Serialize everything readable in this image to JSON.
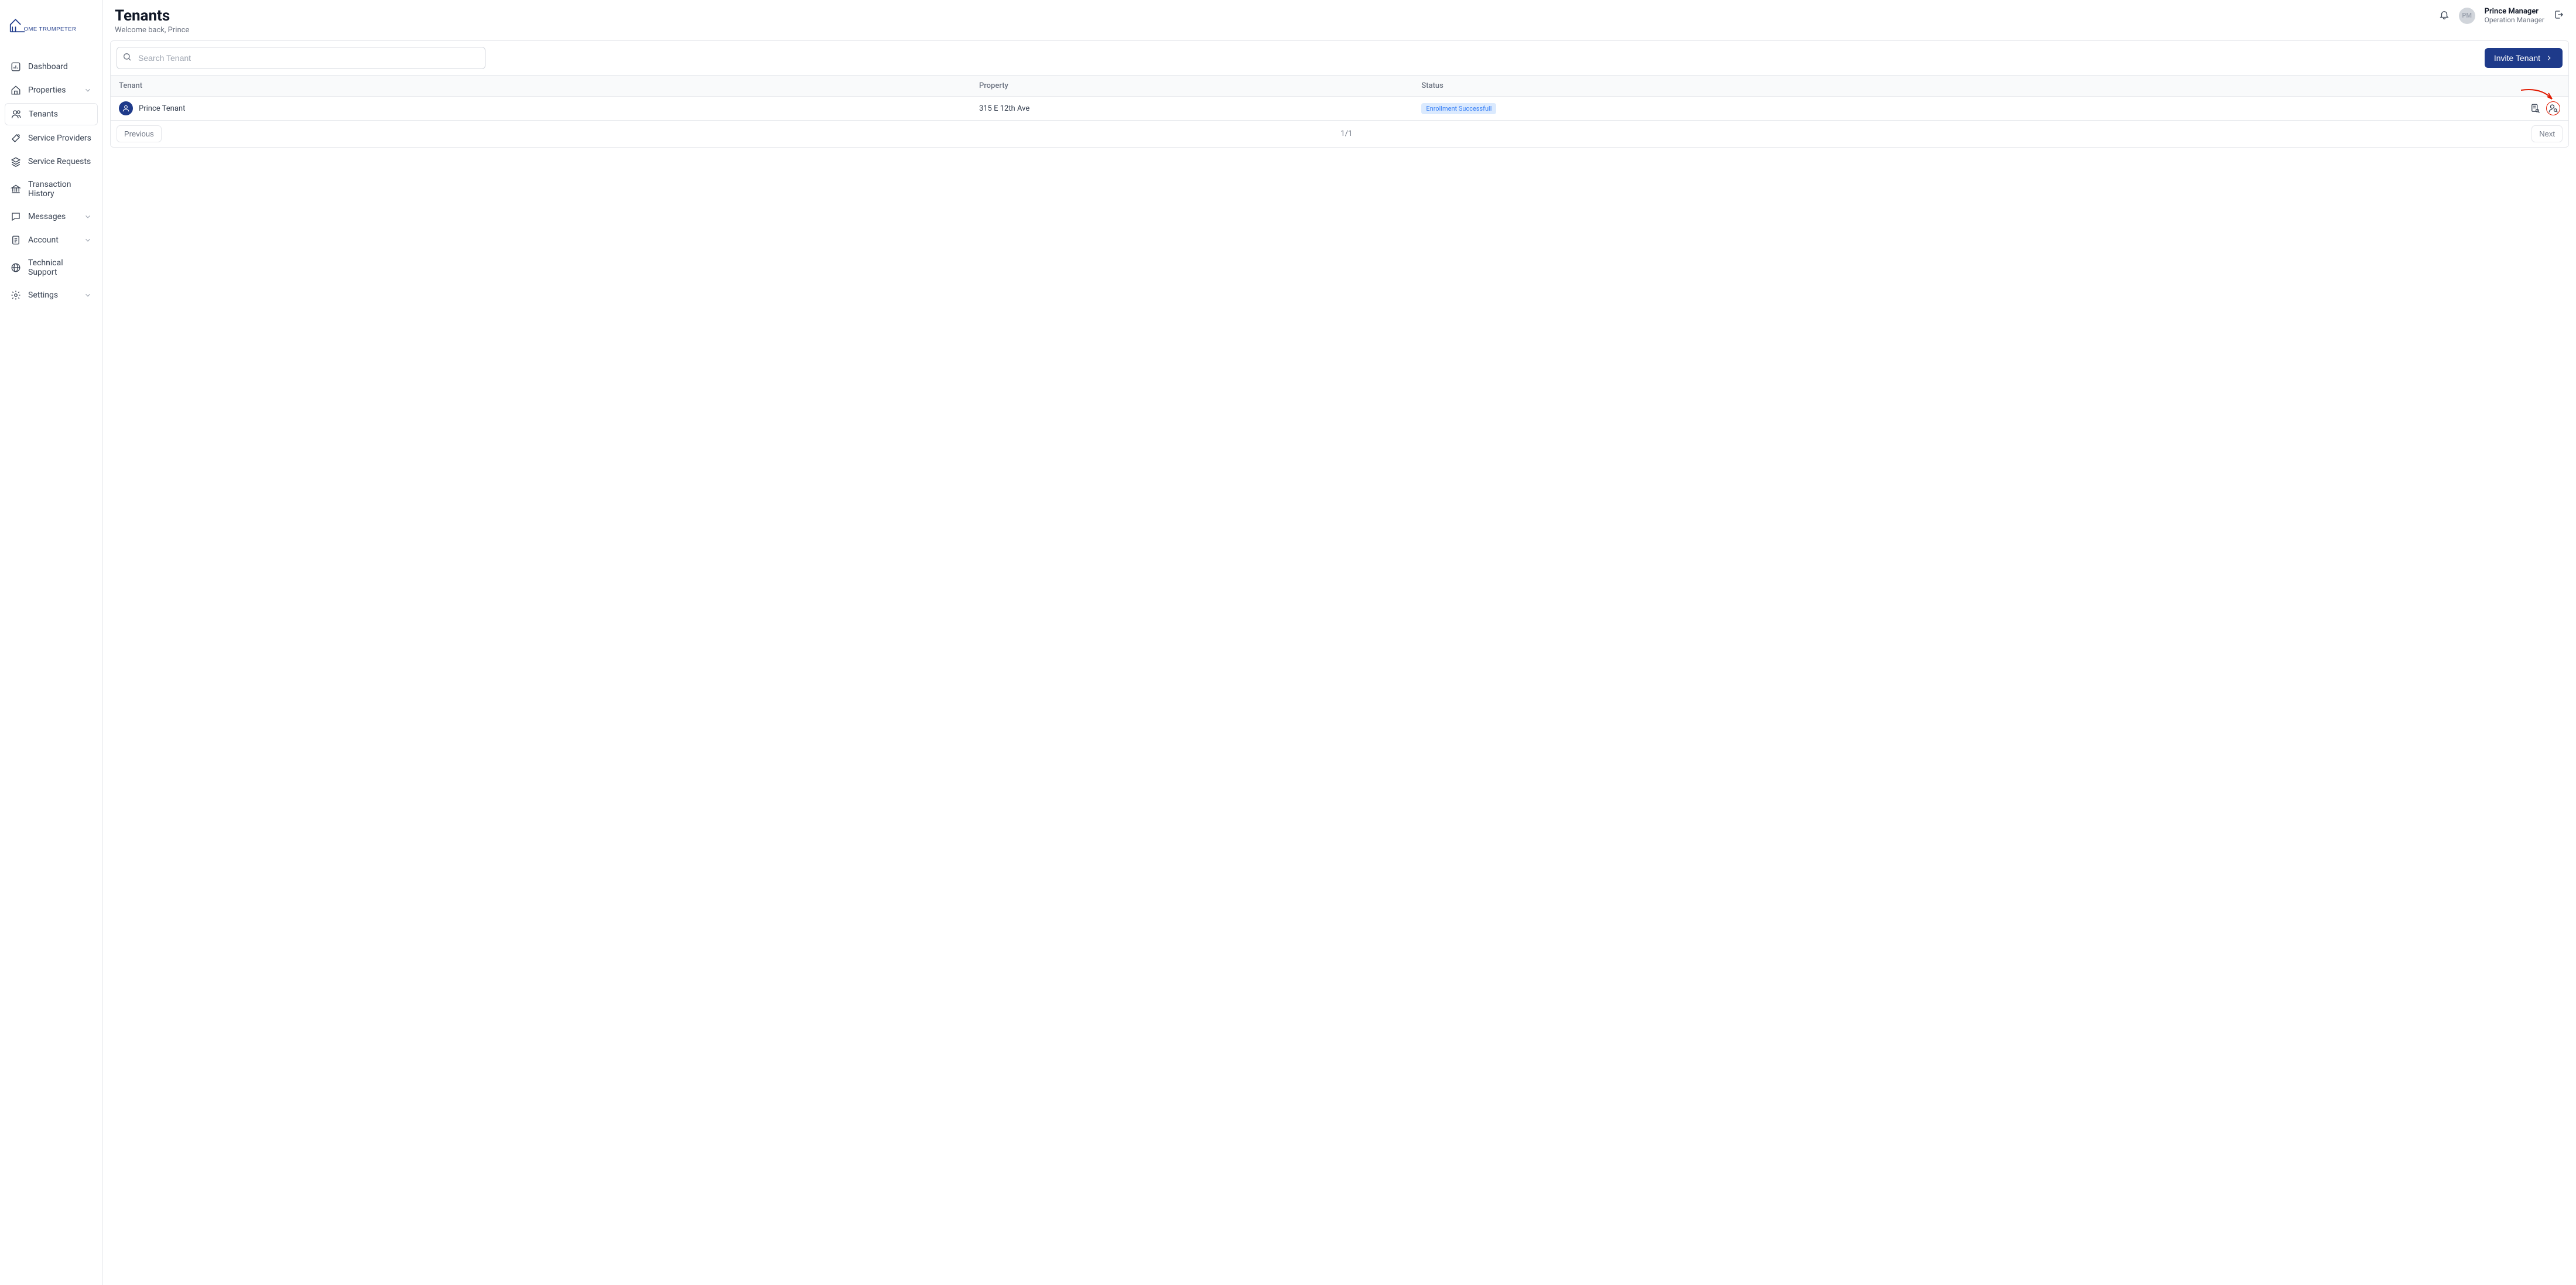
{
  "brand": "OME TRUMPETER",
  "header": {
    "title": "Tenants",
    "subtitle": "Welcome back, Prince",
    "user_name": "Prince Manager",
    "user_role": "Operation Manager",
    "avatar_initials": "PM"
  },
  "sidebar": {
    "items": [
      {
        "icon": "dashboard",
        "label": "Dashboard",
        "expandable": false
      },
      {
        "icon": "home",
        "label": "Properties",
        "expandable": true
      },
      {
        "icon": "users",
        "label": "Tenants",
        "expandable": false,
        "active": true
      },
      {
        "icon": "tools",
        "label": "Service Providers",
        "expandable": false
      },
      {
        "icon": "layers",
        "label": "Service Requests",
        "expandable": false
      },
      {
        "icon": "bank",
        "label": "Transaction History",
        "expandable": false
      },
      {
        "icon": "message",
        "label": "Messages",
        "expandable": true
      },
      {
        "icon": "file",
        "label": "Account",
        "expandable": true
      },
      {
        "icon": "globe",
        "label": "Technical Support",
        "expandable": false
      },
      {
        "icon": "settings",
        "label": "Settings",
        "expandable": true
      }
    ]
  },
  "toolbar": {
    "search_placeholder": "Search Tenant",
    "invite_label": "Invite Tenant"
  },
  "table": {
    "columns": [
      "Tenant",
      "Property",
      "Status"
    ],
    "rows": [
      {
        "tenant": "Prince Tenant",
        "property": "315 E 12th Ave",
        "status": "Enrollment Successfull"
      }
    ]
  },
  "pagination": {
    "prev": "Previous",
    "next": "Next",
    "info": "1/1"
  }
}
